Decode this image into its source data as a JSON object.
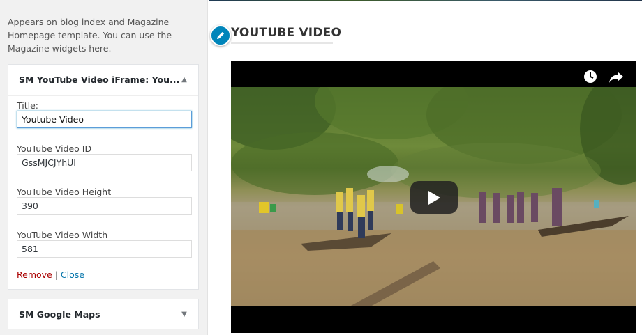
{
  "sidebar": {
    "area_description": "Appears on blog index and Magazine Homepage template. You can use the Magazine widgets here.",
    "widgets": [
      {
        "title": "SM YouTube Video iFrame: You...",
        "expanded": true,
        "fields": {
          "title_label": "Title:",
          "title_value": "Youtube Video",
          "video_id_label": "YouTube Video ID",
          "video_id_value": "GssMJCJYhUI",
          "height_label": "YouTube Video Height",
          "height_value": "390",
          "width_label": "YouTube Video Width",
          "width_value": "581"
        },
        "actions": {
          "remove": "Remove",
          "separator": "|",
          "close": "Close"
        }
      },
      {
        "title": "SM Google Maps",
        "expanded": false
      }
    ]
  },
  "preview": {
    "section_title": "YOUTUBE VIDEO",
    "video": {
      "icons": [
        "watch-later-icon",
        "share-icon",
        "play-icon"
      ]
    }
  },
  "colors": {
    "accent_blue": "#0085ba",
    "link_blue": "#0073aa",
    "remove_red": "#a00",
    "sidebar_bg": "#f1f1f1"
  }
}
